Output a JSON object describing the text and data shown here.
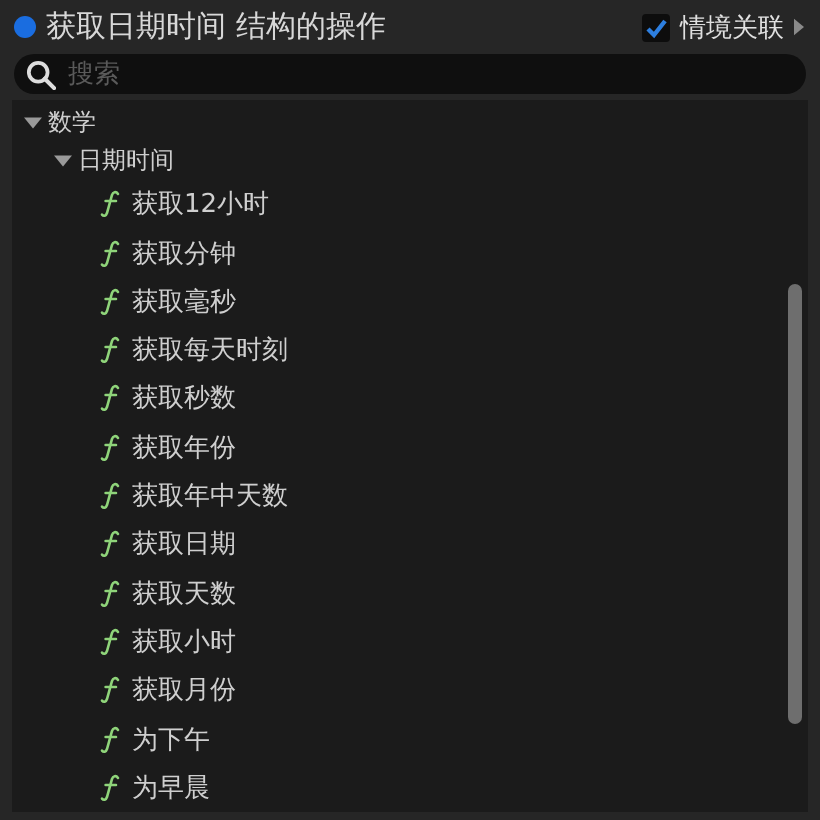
{
  "header": {
    "title": "获取日期时间 结构的操作",
    "context_checkbox": {
      "label": "情境关联",
      "checked": true
    }
  },
  "search": {
    "placeholder": "搜索"
  },
  "tree": [
    {
      "label": "数学",
      "expanded": true,
      "children": [
        {
          "label": "日期时间",
          "expanded": true,
          "children": [
            {
              "label": "获取12小时",
              "kind": "function"
            },
            {
              "label": "获取分钟",
              "kind": "function"
            },
            {
              "label": "获取毫秒",
              "kind": "function"
            },
            {
              "label": "获取每天时刻",
              "kind": "function"
            },
            {
              "label": "获取秒数",
              "kind": "function"
            },
            {
              "label": "获取年份",
              "kind": "function"
            },
            {
              "label": "获取年中天数",
              "kind": "function"
            },
            {
              "label": "获取日期",
              "kind": "function"
            },
            {
              "label": "获取天数",
              "kind": "function"
            },
            {
              "label": "获取小时",
              "kind": "function"
            },
            {
              "label": "获取月份",
              "kind": "function"
            },
            {
              "label": "为下午",
              "kind": "function"
            },
            {
              "label": "为早晨",
              "kind": "function"
            }
          ]
        }
      ]
    }
  ]
}
